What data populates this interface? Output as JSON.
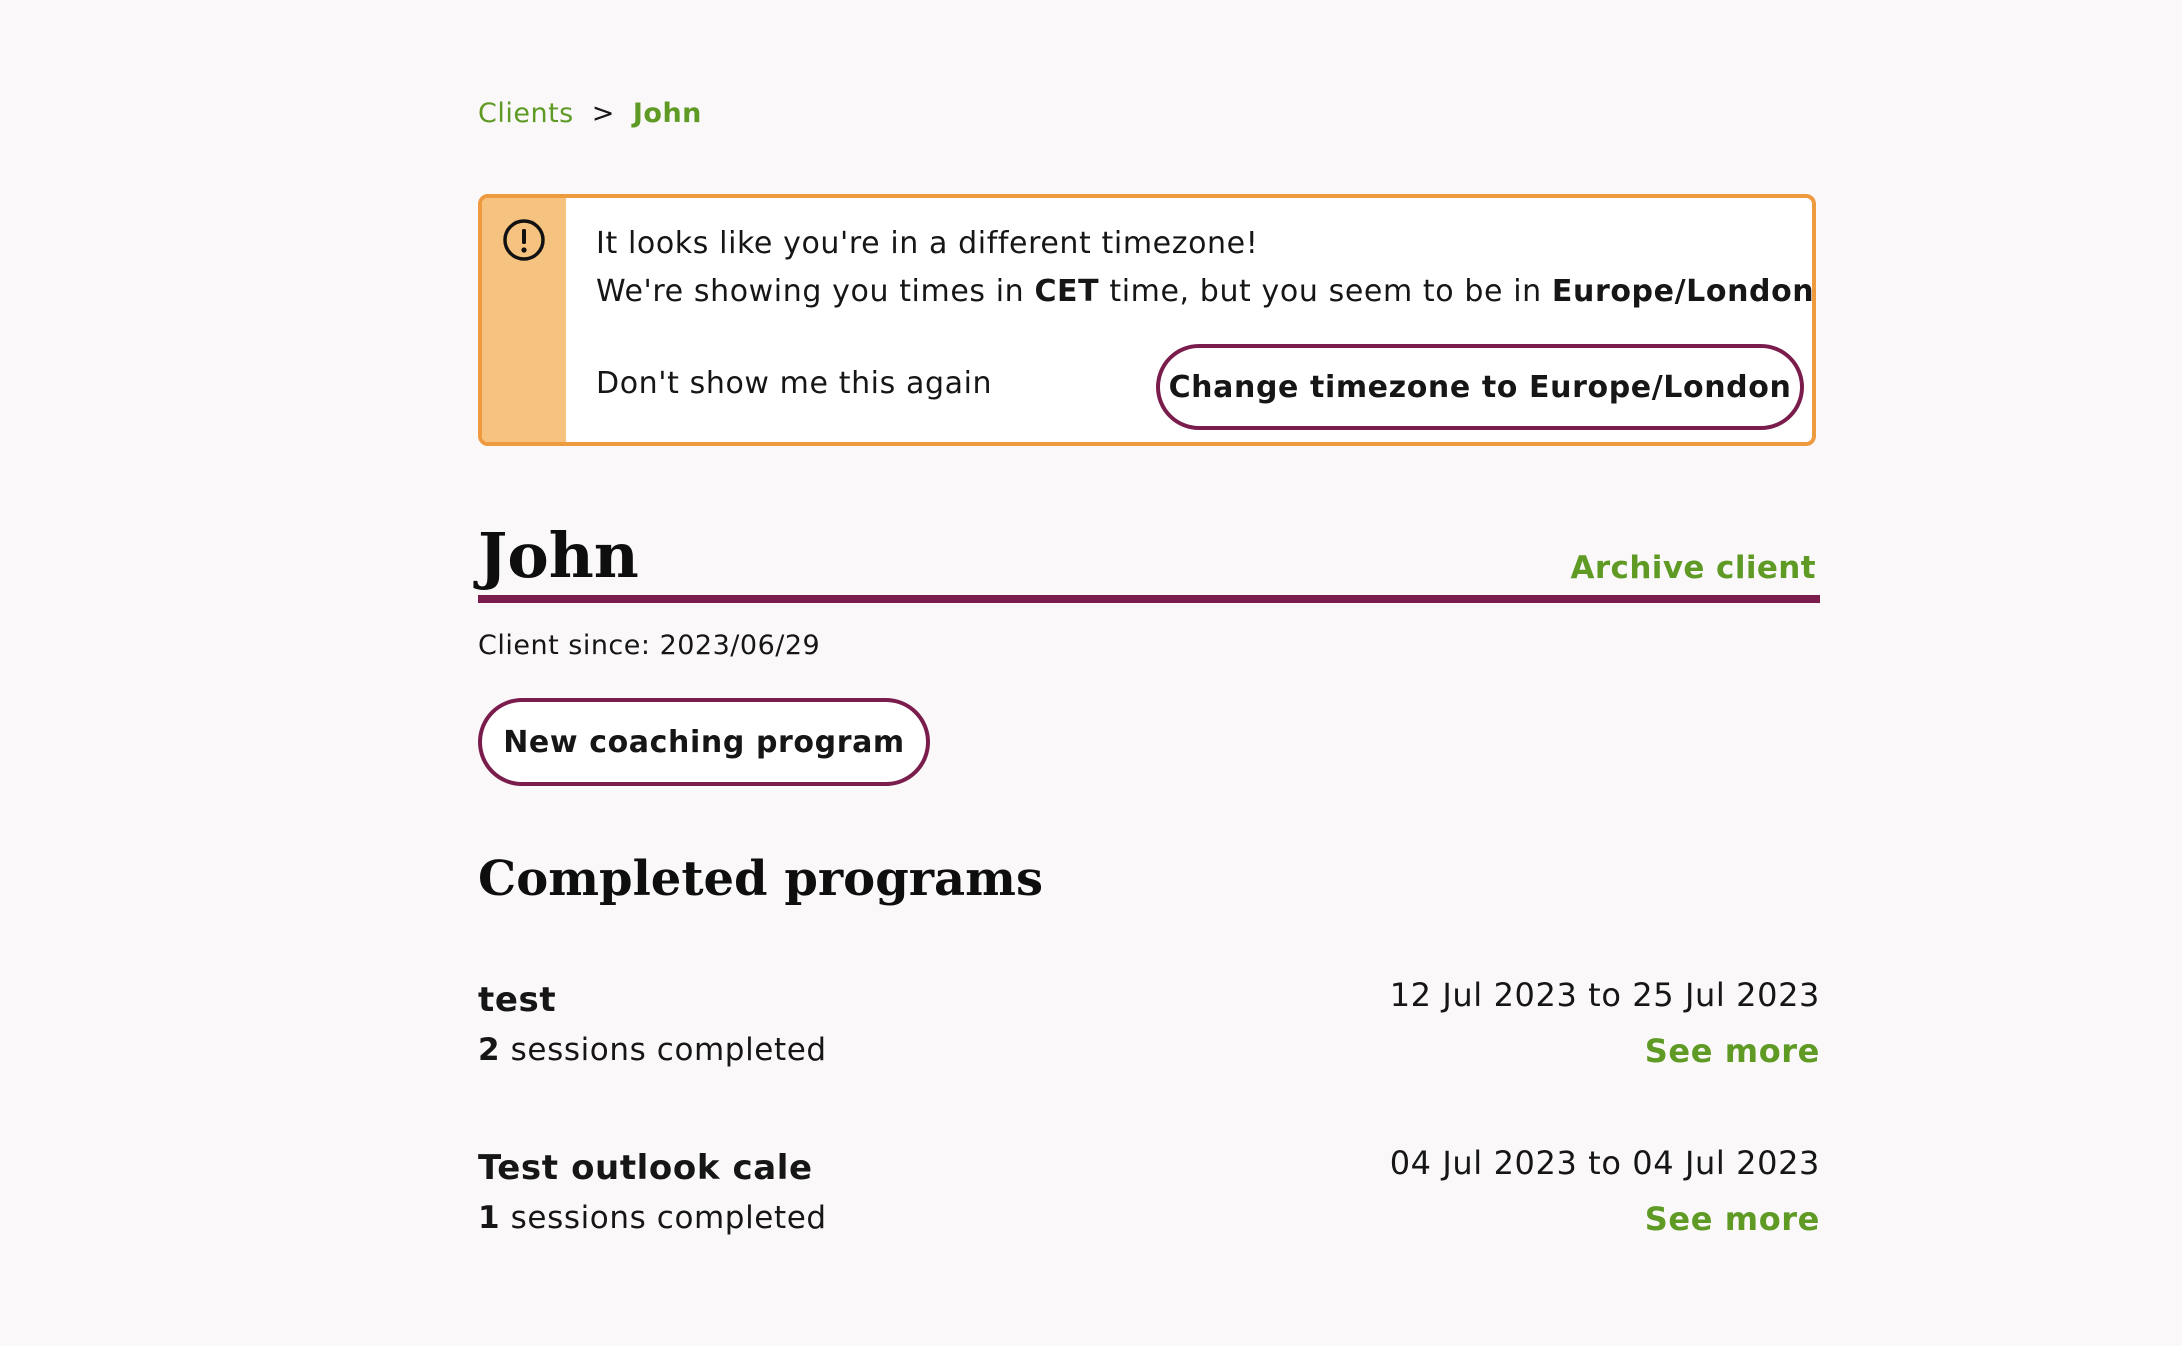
{
  "breadcrumb": {
    "parent": "Clients",
    "separator": ">",
    "current": "John"
  },
  "timezone_alert": {
    "line1": "It looks like you're in a different timezone!",
    "line2_before": "We're showing you times in ",
    "current_timezone": "CET",
    "line2_middle": " time, but you seem to be in ",
    "detected_timezone": "Europe/London",
    "line2_after": ".",
    "dismiss_label": "Don't show me this again",
    "change_button_label": "Change timezone to Europe/London",
    "icon": "exclamation-circle-icon",
    "colors": {
      "border": "#ee9a3f",
      "sidebar": "#f6c27f"
    }
  },
  "client": {
    "name": "John",
    "archive_label": "Archive client",
    "since_label": "Client since:",
    "since_date": "2023/06/29",
    "new_program_label": "New coaching program"
  },
  "completed_programs": {
    "title": "Completed programs",
    "items": [
      {
        "name": "test",
        "sessions_count": "2",
        "sessions_label": "sessions completed",
        "date_range": "12 Jul 2023 to 25 Jul 2023",
        "see_more_label": "See more"
      },
      {
        "name": "Test outlook cale",
        "sessions_count": "1",
        "sessions_label": "sessions completed",
        "date_range": "04 Jul 2023 to 04 Jul 2023",
        "see_more_label": "See more"
      }
    ]
  },
  "colors": {
    "accent_green": "#5e9a24",
    "accent_plum": "#7a1c4c",
    "background": "#faf8f9"
  }
}
